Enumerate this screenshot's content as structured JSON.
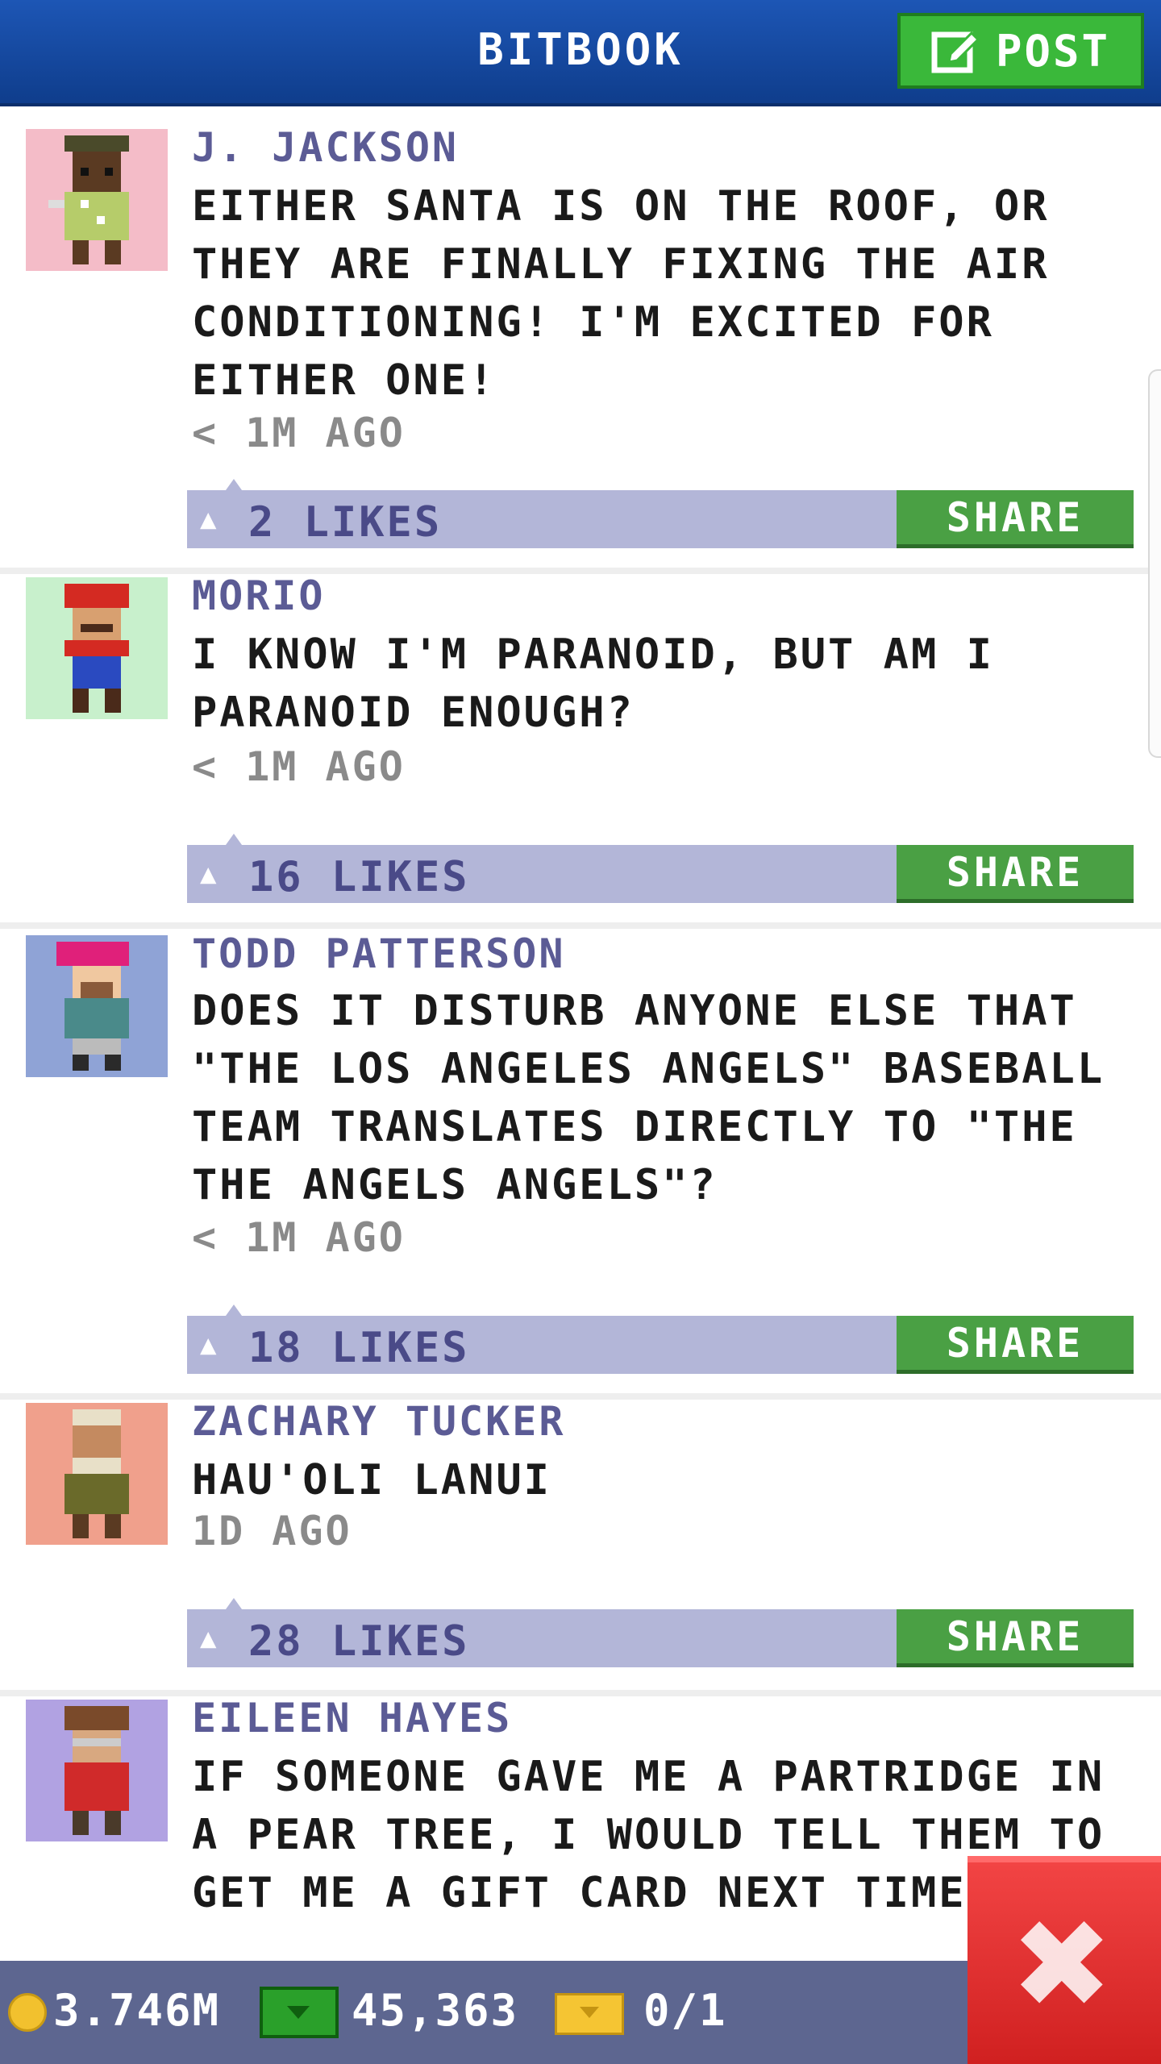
{
  "header": {
    "title": "BITBOOK",
    "post_label": "POST"
  },
  "posts": [
    {
      "author": "J. JACKSON",
      "message": "EITHER SANTA IS ON THE ROOF, OR THEY ARE FINALLY FIXING THE AIR CONDITIONING! I'M EXCITED FOR EITHER ONE!",
      "time": "< 1M AGO",
      "likes": "2 LIKES",
      "share": "SHARE",
      "avatar_bg": "#f4bcc8"
    },
    {
      "author": "MORIO",
      "message": "I KNOW I'M PARANOID, BUT AM I PARANOID ENOUGH?",
      "time": "< 1M AGO",
      "likes": "16 LIKES",
      "share": "SHARE",
      "avatar_bg": "#c8f0cc"
    },
    {
      "author": "TODD PATTERSON",
      "message": "DOES IT DISTURB ANYONE ELSE THAT \"THE LOS ANGELES ANGELS\" BASEBALL TEAM TRANSLATES DIRECTLY TO \"THE THE ANGELS ANGELS\"?",
      "time": "< 1M AGO",
      "likes": "18 LIKES",
      "share": "SHARE",
      "avatar_bg": "#8fa3d6"
    },
    {
      "author": "ZACHARY TUCKER",
      "message": "HAU'OLI LANUI",
      "time": "1D AGO",
      "likes": "28 LIKES",
      "share": "SHARE",
      "avatar_bg": "#f0a08c"
    },
    {
      "author": "EILEEN HAYES",
      "message": "IF SOMEONE GAVE ME A PARTRIDGE IN A PEAR TREE, I WOULD TELL THEM TO GET ME A GIFT CARD NEXT TIME.",
      "time": "",
      "likes": "",
      "share": "",
      "avatar_bg": "#b1a2e2"
    }
  ],
  "bottom_bar": {
    "coins": "3.746M",
    "bux": "45,363",
    "tickets": "0/1"
  },
  "icons": {
    "post": "edit-icon",
    "thumb": "thumbs-up-icon",
    "close": "close-icon",
    "coin": "coin-icon",
    "cash": "bux-icon",
    "ticket": "ticket-icon"
  },
  "colors": {
    "header": "#1d56b5",
    "share": "#4aa044",
    "likes_bar": "#b3b6d8",
    "bottom_bar": "#5d6690",
    "close": "#e02828"
  }
}
